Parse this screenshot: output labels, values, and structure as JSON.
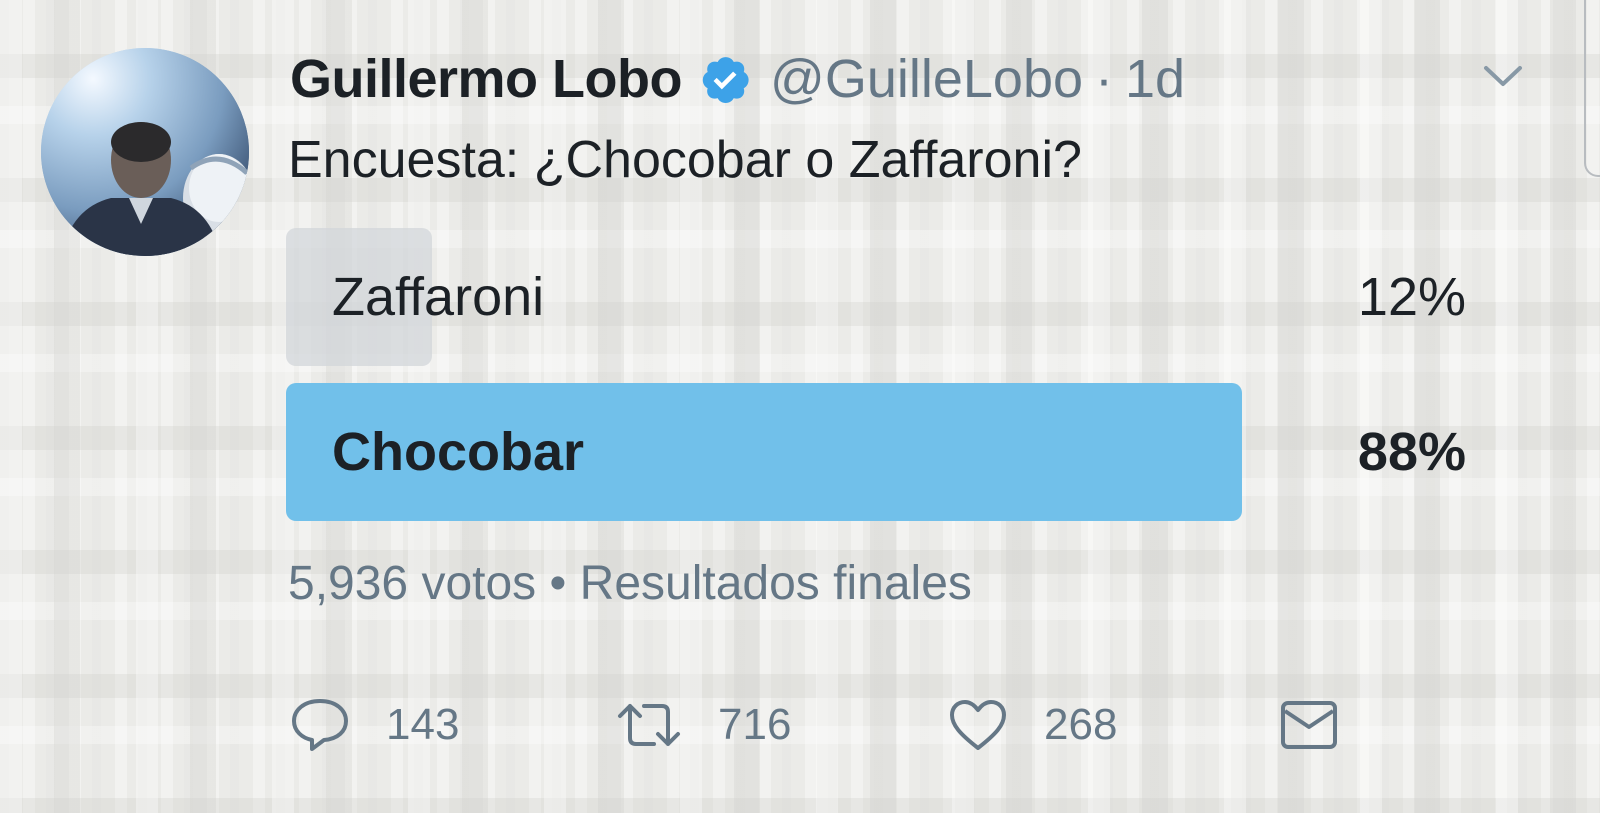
{
  "tweet": {
    "author_name": "Guillermo Lobo",
    "handle": "@GuilleLobo",
    "separator": "·",
    "time": "1d",
    "verified": true,
    "text": "Encuesta: ¿Chocobar o Zaffaroni?"
  },
  "poll": {
    "options": [
      {
        "label": "Zaffaroni",
        "percent_text": "12%",
        "percent": 12,
        "winner": false,
        "bar_color": "#d2d6da"
      },
      {
        "label": "Chocobar",
        "percent_text": "88%",
        "percent": 88,
        "winner": true,
        "bar_color": "#71c0ea"
      }
    ],
    "meta": "5,936 votos • Resultados finales"
  },
  "actions": {
    "reply": {
      "icon": "reply-icon",
      "count": "143"
    },
    "retweet": {
      "icon": "retweet-icon",
      "count": "716"
    },
    "like": {
      "icon": "heart-icon",
      "count": "268"
    },
    "message": {
      "icon": "envelope-icon"
    }
  },
  "colors": {
    "text_primary": "#1c2126",
    "text_secondary": "#657786",
    "verified_blue": "#3da2e8",
    "winner_bar": "#71c0ea",
    "loser_bar": "#d2d6da"
  }
}
